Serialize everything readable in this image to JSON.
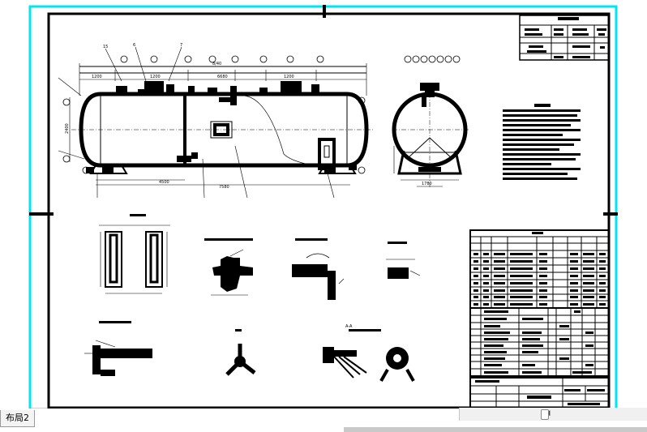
{
  "colors": {
    "viewport_frame": "#00e5f5",
    "linework": "#000000",
    "heavy_linework": "#111111",
    "paper": "#ffffff"
  },
  "layout_tabs": [
    {
      "label": "布局2",
      "active": true
    }
  ],
  "scrollbar": {
    "left_arrow_icon": "chevron-left-icon",
    "right_arrow_icon": "chevron-right-icon"
  },
  "drawing": {
    "main_view_dimensions": [
      "8/40",
      "8040",
      "6680",
      "1200",
      "1200",
      "1200",
      "7580",
      "4500"
    ],
    "main_view_callouts": [
      "15",
      "6",
      "7",
      "A",
      "B",
      "C",
      "D",
      "E",
      "F",
      "G",
      "H"
    ],
    "section_label": "A-A"
  }
}
